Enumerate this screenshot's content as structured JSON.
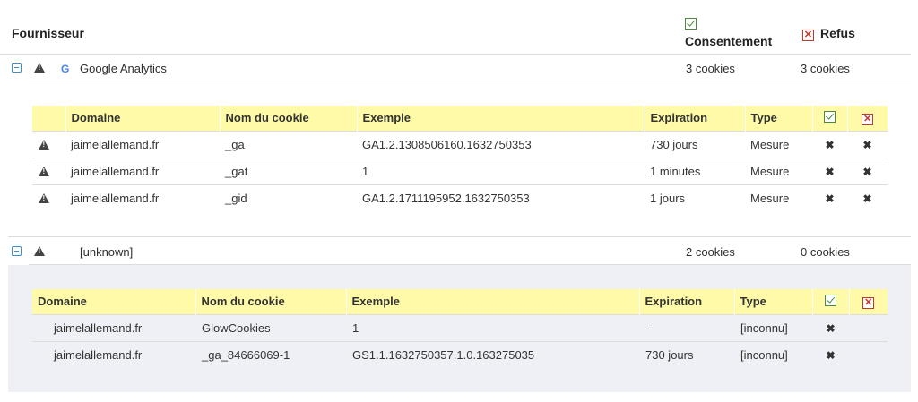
{
  "header": {
    "vendor_label": "Fournisseur",
    "consent_label": "Consentement",
    "refusal_label": "Refus"
  },
  "vendors": [
    {
      "name": "Google Analytics",
      "logo": "google-logo",
      "consent_count": "3 cookies",
      "refusal_count": "3 cookies",
      "expanded": true,
      "columns": [
        "Domaine",
        "Nom du cookie",
        "Exemple",
        "Expiration",
        "Type"
      ],
      "cookies": [
        {
          "domain": "jaimelallemand.fr",
          "name": "_ga",
          "example": "GA1.2.1308506160.1632750353",
          "expiration": "730 jours",
          "type": "Mesure"
        },
        {
          "domain": "jaimelallemand.fr",
          "name": "_gat",
          "example": "1",
          "expiration": "1 minutes",
          "type": "Mesure"
        },
        {
          "domain": "jaimelallemand.fr",
          "name": "_gid",
          "example": "GA1.2.1711195952.1632750353",
          "expiration": "1 jours",
          "type": "Mesure"
        }
      ]
    },
    {
      "name": "[unknown]",
      "consent_count": "2 cookies",
      "refusal_count": "0 cookies",
      "expanded": true,
      "columns": [
        "Domaine",
        "Nom du cookie",
        "Exemple",
        "Expiration",
        "Type"
      ],
      "cookies": [
        {
          "domain": "jaimelallemand.fr",
          "name": "GlowCookies",
          "example": "1",
          "expiration": "-",
          "type": "[inconnu]"
        },
        {
          "domain": "jaimelallemand.fr",
          "name": "_ga_84666069-1",
          "example": "GS1.1.1632750357.1.0.163275035",
          "expiration": "730 jours",
          "type": "[inconnu]"
        }
      ]
    }
  ],
  "colors": {
    "table_header_bg": "#fefaa7",
    "unknown_panel_bg": "#eef0f5",
    "accept_green": "#4a8a3a",
    "refuse_red": "#c0392b",
    "toggle_blue": "#3a8fd0"
  }
}
